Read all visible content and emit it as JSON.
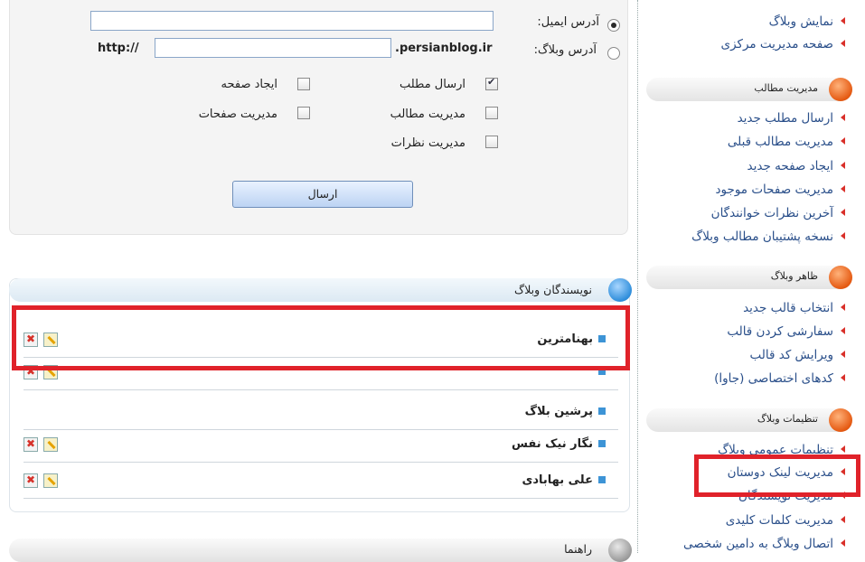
{
  "sidebar": {
    "top_links": [
      "نمایش وبلاگ",
      "صفحه مدیریت مرکزی"
    ],
    "sections": [
      {
        "title": "مدیریت مطالب",
        "items": [
          "ارسال مطلب جدید",
          "مدیریت مطالب قبلی",
          "ایجاد صفحه جدید",
          "مدیریت صفحات موجود",
          "آخرین نظرات خوانندگان",
          "نسخه پشتیبان مطالب وبلاگ"
        ]
      },
      {
        "title": "ظاهر وبلاگ",
        "items": [
          "انتخاب قالب جدید",
          "سفارشی کردن قالب",
          "ویرایش کد قالب",
          "کدهای اختصاصی (جاوا)"
        ]
      },
      {
        "title": "تنظیمات وبلاگ",
        "items": [
          "تنظیمات عمومی وبلاگ",
          "مدیریت لینک دوستان",
          "مدیریت نویسندگان",
          "مدیریت کلمات کلیدی",
          "اتصال وبلاگ به دامین شخصی"
        ]
      }
    ]
  },
  "form": {
    "email_label": "آدرس ایمیل:",
    "email_value": "",
    "blog_label": "آدرس وبلاگ:",
    "blog_prefix": "http://",
    "blog_value": "",
    "blog_suffix": ".persianblog.ir",
    "permissions": [
      {
        "label": "ارسال مطلب",
        "checked": true
      },
      {
        "label": "ایجاد صفحه",
        "checked": false
      },
      {
        "label": "مدیریت مطالب",
        "checked": false
      },
      {
        "label": "مدیریت صفحات",
        "checked": false
      },
      {
        "label": "مدیریت نظرات",
        "checked": false
      }
    ],
    "submit_label": "ارسال"
  },
  "writers": {
    "title": "نویسندگان وبلاگ",
    "rows": [
      {
        "name": "بهنامترین"
      },
      {
        "name": ""
      },
      {
        "name": "پرشین بلاگ"
      },
      {
        "name": "نگار نیک نفس"
      },
      {
        "name": "علی بهابادی"
      }
    ]
  },
  "help": {
    "title": "راهنما"
  }
}
